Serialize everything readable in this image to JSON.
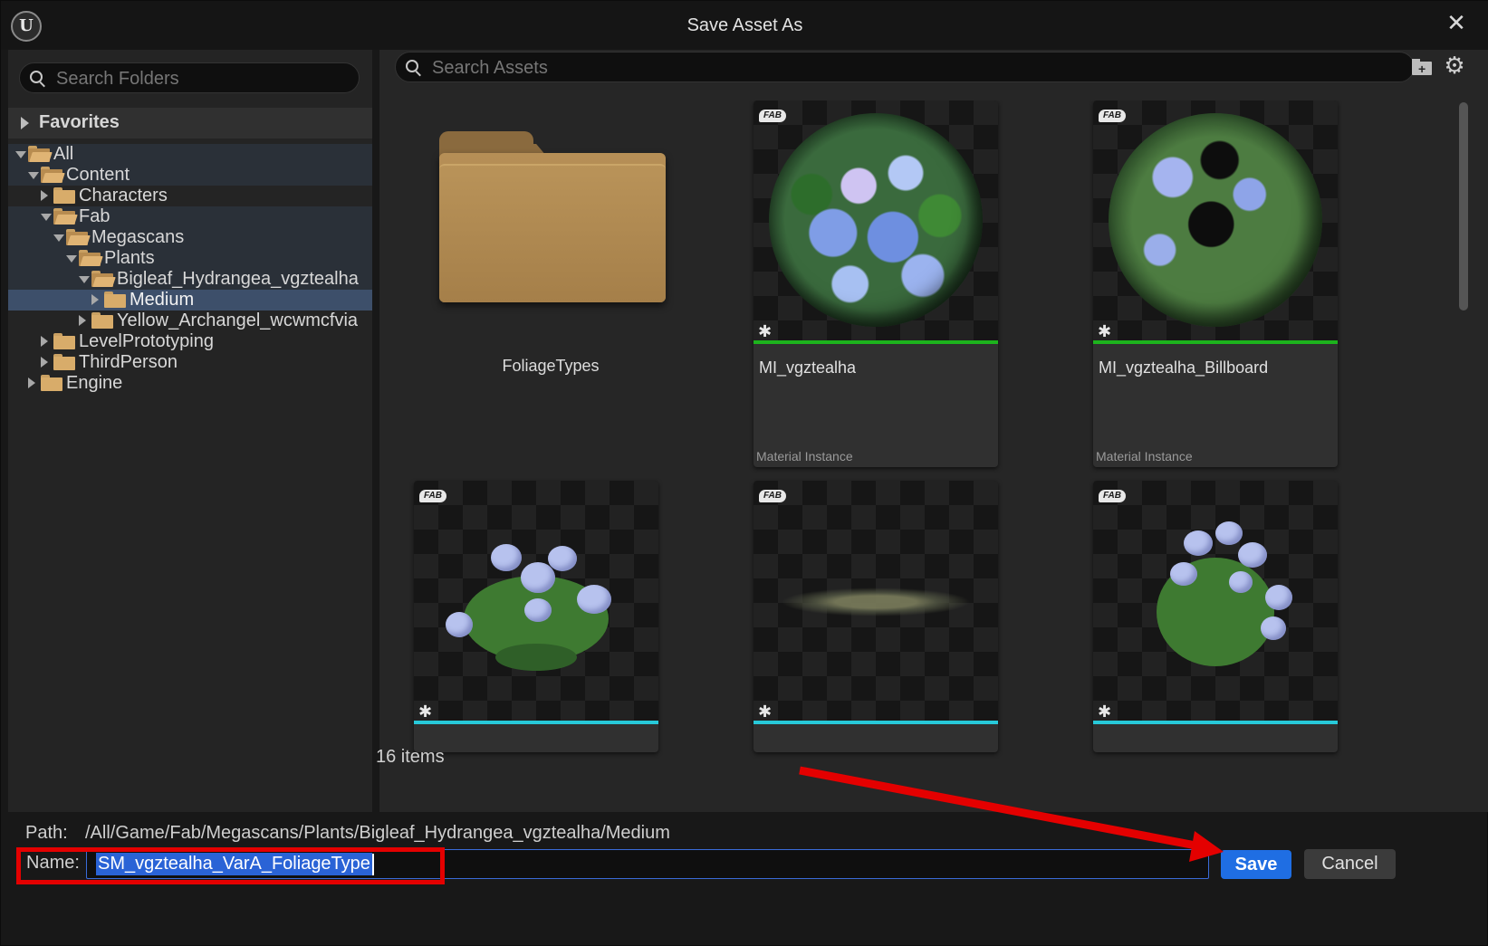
{
  "window": {
    "title": "Save Asset As"
  },
  "left": {
    "search_placeholder": "Search Folders",
    "favorites_label": "Favorites",
    "tree": [
      {
        "label": "All",
        "state": "expanded",
        "open": true,
        "inpath": true
      },
      {
        "label": "Content",
        "state": "expanded",
        "open": true,
        "inpath": true
      },
      {
        "label": "Characters",
        "state": "collapsed",
        "open": false,
        "inpath": false
      },
      {
        "label": "Fab",
        "state": "expanded",
        "open": true,
        "inpath": true
      },
      {
        "label": "Megascans",
        "state": "expanded",
        "open": true,
        "inpath": true
      },
      {
        "label": "Plants",
        "state": "expanded",
        "open": true,
        "inpath": true
      },
      {
        "label": "Bigleaf_Hydrangea_vgztealha",
        "state": "expanded",
        "open": true,
        "inpath": true
      },
      {
        "label": "Medium",
        "state": "collapsed",
        "open": false,
        "inpath": true,
        "selected": true
      },
      {
        "label": "Yellow_Archangel_wcwmcfvia",
        "state": "collapsed",
        "open": false,
        "inpath": false
      },
      {
        "label": "LevelPrototyping",
        "state": "collapsed",
        "open": false,
        "inpath": false
      },
      {
        "label": "ThirdPerson",
        "state": "collapsed",
        "open": false,
        "inpath": false
      },
      {
        "label": "Engine",
        "state": "collapsed",
        "open": false,
        "inpath": false
      }
    ]
  },
  "right": {
    "search_placeholder": "Search Assets",
    "folder_tile": {
      "name": "FoliageTypes"
    },
    "assets": [
      {
        "name": "MI_vgztealha",
        "type": "Material Instance",
        "badge": "FAB",
        "strip_color": "#1db31d"
      },
      {
        "name": "MI_vgztealha_Billboard",
        "type": "Material Instance",
        "badge": "FAB",
        "strip_color": "#1db31d"
      },
      {
        "badge": "FAB",
        "strip_color": "#27c9d9"
      },
      {
        "badge": "FAB",
        "strip_color": "#27c9d9"
      },
      {
        "badge": "FAB",
        "strip_color": "#27c9d9"
      }
    ],
    "item_count": "16 items"
  },
  "footer": {
    "path_label": "Path:",
    "path_value": "/All/Game/Fab/Megascans/Plants/Bigleaf_Hydrangea_vgztealha/Medium",
    "name_label": "Name:",
    "name_value": "SM_vgztealha_VarA_FoliageType",
    "save_label": "Save",
    "cancel_label": "Cancel"
  },
  "annotations": {
    "highlight_color": "#e40000"
  }
}
